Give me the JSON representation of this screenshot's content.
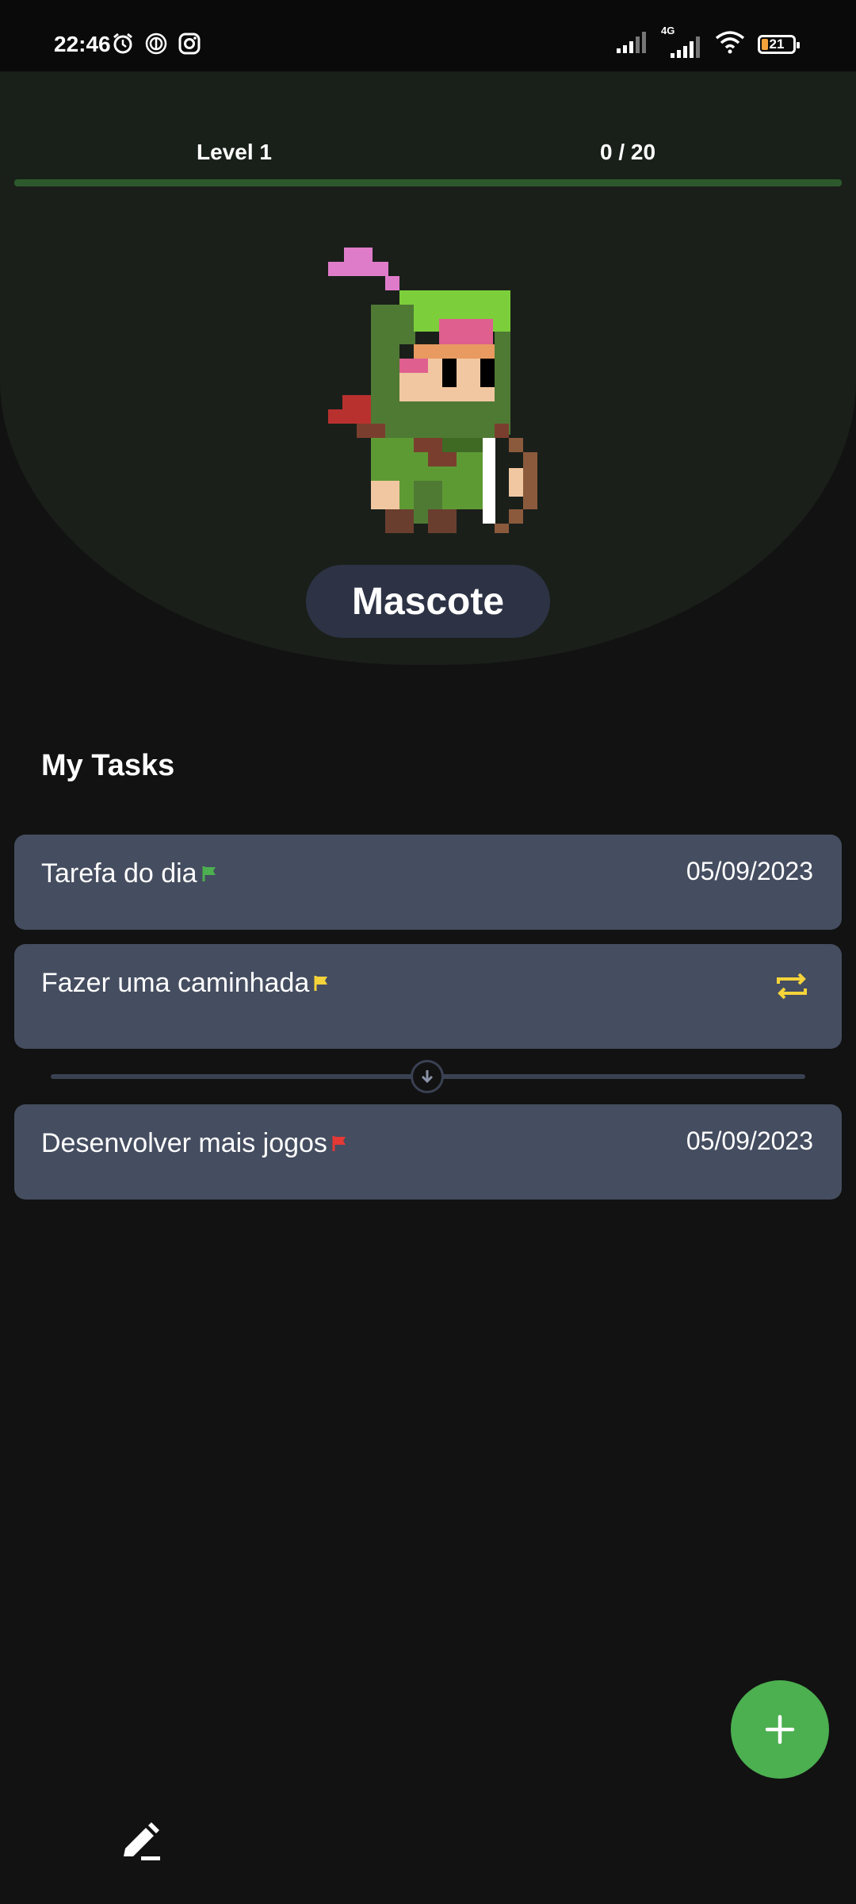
{
  "status_bar": {
    "time": "22:46",
    "battery": "21",
    "network": "4G",
    "icons": [
      "alarm-icon",
      "fingerprint-icon",
      "instagram-icon",
      "signal-icon",
      "signal-4g-icon",
      "wifi-icon",
      "battery-icon"
    ]
  },
  "progress": {
    "level": "Level 1",
    "xp": "0 / 20",
    "xp_fraction": 0
  },
  "mascot": {
    "button_label": "Mascote"
  },
  "tasks_section": {
    "title": "My Tasks"
  },
  "tasks": [
    {
      "title": "Tarefa do dia",
      "date": "05/09/2023",
      "flag_color": "#4caf50",
      "icon": "flag-icon"
    },
    {
      "title": "Fazer uma caminhada",
      "date": "",
      "flag_color": "#f5d33a",
      "icon": "repeat-icon"
    },
    {
      "title": "Desenvolver mais jogos",
      "date": "05/09/2023",
      "flag_color": "#e53935",
      "icon": "flag-icon"
    }
  ],
  "colors": {
    "accent": "#4caf50",
    "task_card": "#454d60",
    "background": "#121212",
    "repeat_icon": "#f5d33a"
  },
  "fab": {
    "icon": "plus-icon"
  },
  "bottom": {
    "icon": "edit-icon"
  }
}
